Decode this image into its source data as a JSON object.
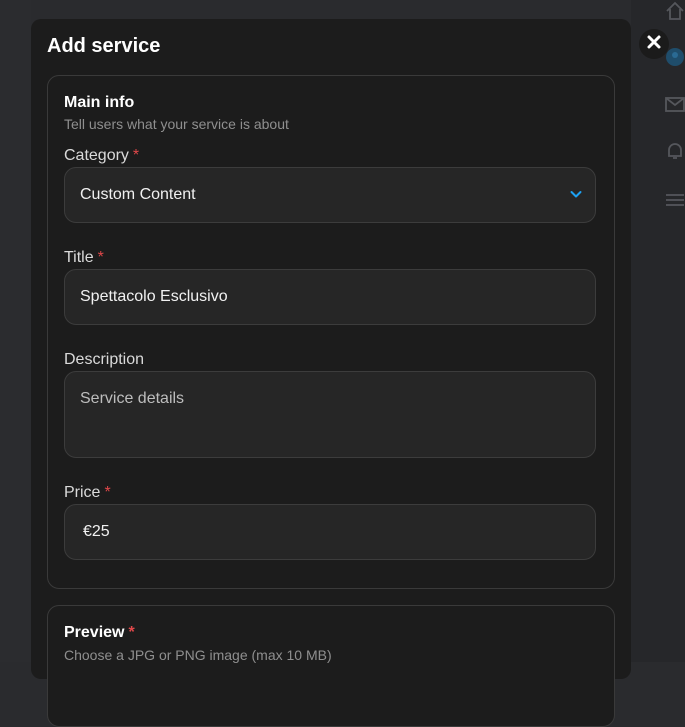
{
  "modal": {
    "title": "Add service"
  },
  "main_info": {
    "title": "Main info",
    "subtitle": "Tell users what your service is about",
    "category": {
      "label": "Category",
      "required_mark": "*",
      "value": "Custom Content"
    },
    "title_field": {
      "label": "Title",
      "required_mark": "*",
      "value": "Spettacolo Esclusivo"
    },
    "description": {
      "label": "Description",
      "placeholder": "Service details"
    },
    "price": {
      "label": "Price",
      "required_mark": "*",
      "value": "€25"
    }
  },
  "preview": {
    "title": "Preview",
    "required_mark": "*",
    "subtitle": "Choose a JPG or PNG image (max 10 MB)"
  },
  "icons": {
    "close": "close-icon",
    "chevron": "chevron-down-icon",
    "rail": [
      "home-icon",
      "user-icon",
      "mail-icon",
      "bell-icon",
      "menu-icon"
    ]
  },
  "colors": {
    "accent": "#1da1f2",
    "required": "#e0484a",
    "modal_bg": "#1c1c1c",
    "field_bg": "#262626"
  }
}
